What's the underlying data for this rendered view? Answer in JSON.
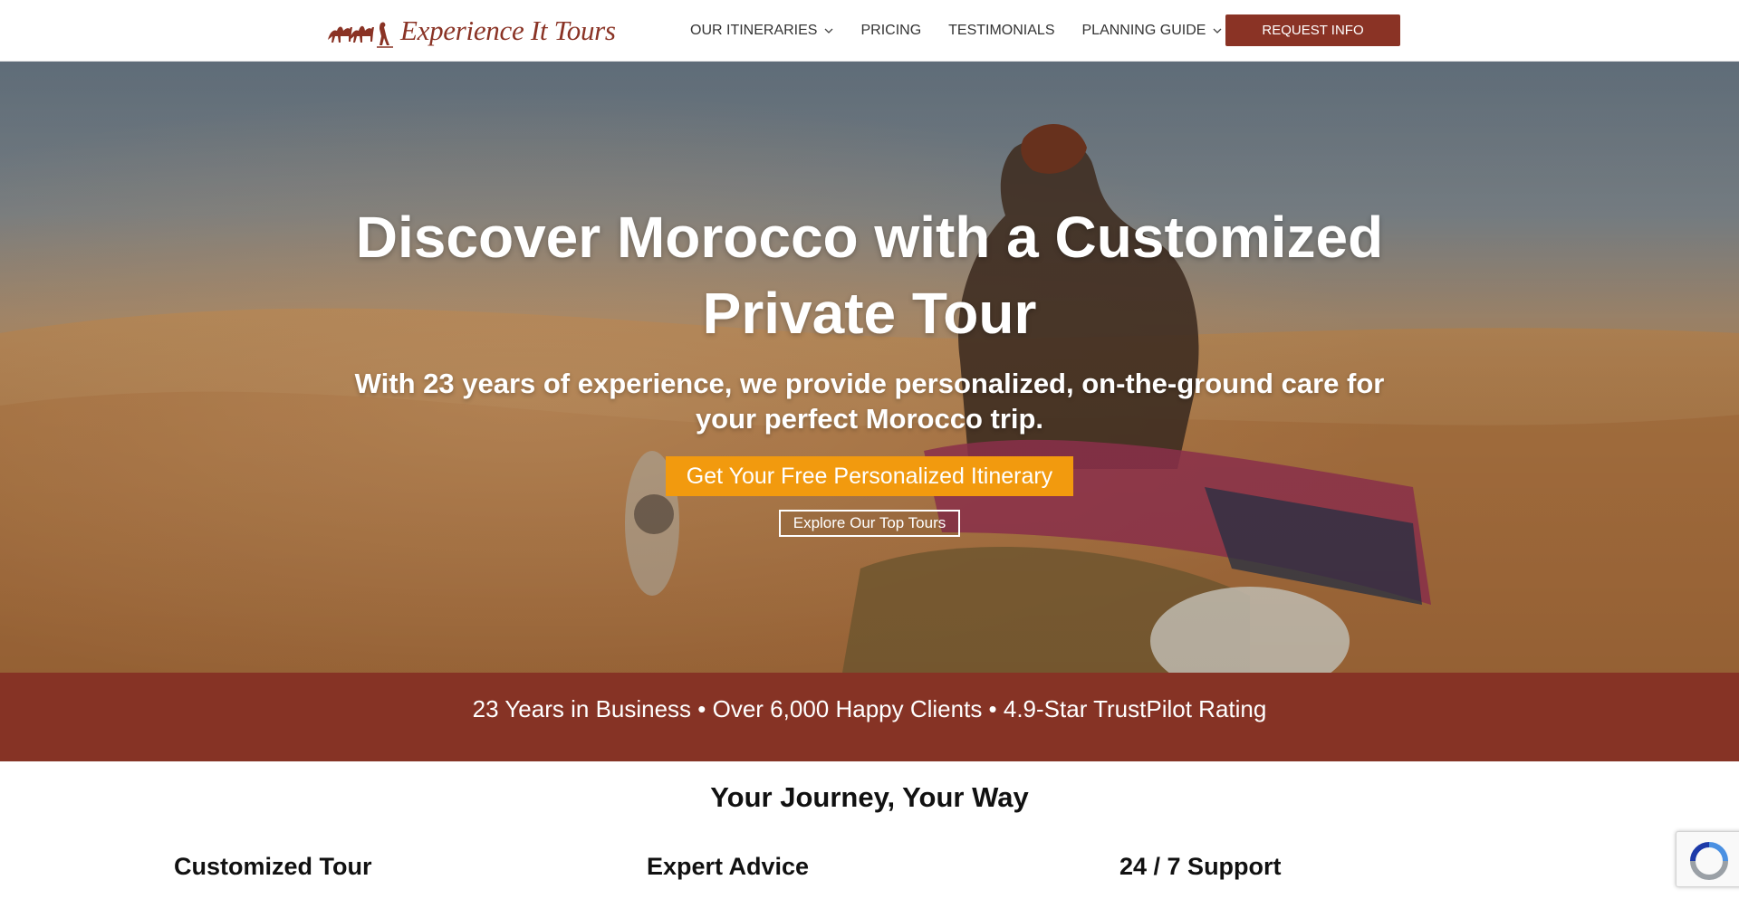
{
  "header": {
    "logo_text": "Experience It Tours",
    "nav": [
      {
        "label": "OUR ITINERARIES",
        "has_dropdown": true
      },
      {
        "label": "PRICING",
        "has_dropdown": false
      },
      {
        "label": "TESTIMONIALS",
        "has_dropdown": false
      },
      {
        "label": "PLANNING GUIDE",
        "has_dropdown": true
      }
    ],
    "cta_label": "REQUEST INFO"
  },
  "hero": {
    "title": "Discover Morocco with a Customized Private Tour",
    "subtitle": "With 23 years of experience, we provide personalized, on-the-ground care for your perfect Morocco trip.",
    "primary_cta": "Get Your Free Personalized Itinerary",
    "secondary_cta": "Explore Our Top Tours"
  },
  "stats_band": {
    "text": "23 Years in Business • Over 6,000 Happy Clients • 4.9-Star TrustPilot Rating"
  },
  "features_section": {
    "title": "Your Journey, Your Way",
    "items": [
      {
        "title": "Customized Tour"
      },
      {
        "title": "Expert Advice"
      },
      {
        "title": "24 / 7 Support"
      }
    ]
  },
  "icons": {
    "logo": "camel-caravan-logo-icon",
    "dropdown": "chevron-down-icon",
    "recaptcha": "recaptcha-icon"
  },
  "colors": {
    "brand": "#8a3325",
    "band": "#863325",
    "accent": "#f29a0e"
  }
}
